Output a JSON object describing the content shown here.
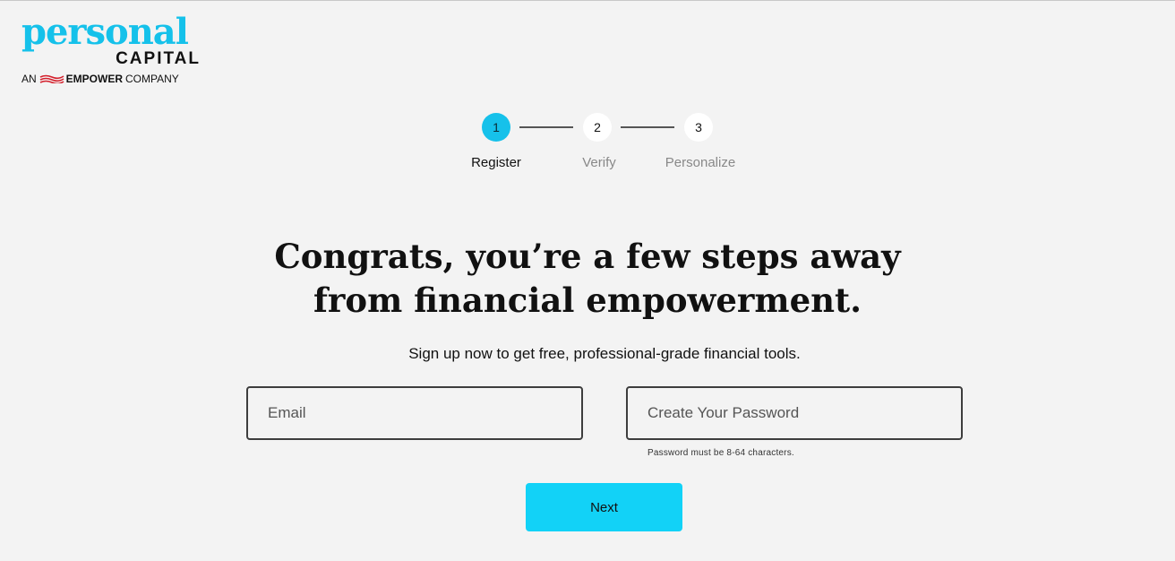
{
  "logo": {
    "wordmark": "personal",
    "submark": "CAPITAL",
    "tagline_prefix": "AN",
    "tagline_brand": "EMPOWER",
    "tagline_suffix": "COMPANY",
    "brand_color": "#15c1ea",
    "flag_color": "#d4202c"
  },
  "stepper": {
    "steps": [
      {
        "number": "1",
        "label": "Register",
        "active": true
      },
      {
        "number": "2",
        "label": "Verify",
        "active": false
      },
      {
        "number": "3",
        "label": "Personalize",
        "active": false
      }
    ],
    "active_color": "#16c1ea"
  },
  "main": {
    "headline_line1": "Congrats, you’re a few steps away",
    "headline_line2": "from financial empowerment.",
    "subhead": "Sign up now to get free, professional-grade financial tools."
  },
  "form": {
    "email": {
      "placeholder": "Email",
      "value": ""
    },
    "password": {
      "placeholder": "Create Your Password",
      "value": ""
    },
    "password_hint": "Password must be 8-64 characters.",
    "next_label": "Next",
    "button_color": "#12d2f7"
  }
}
